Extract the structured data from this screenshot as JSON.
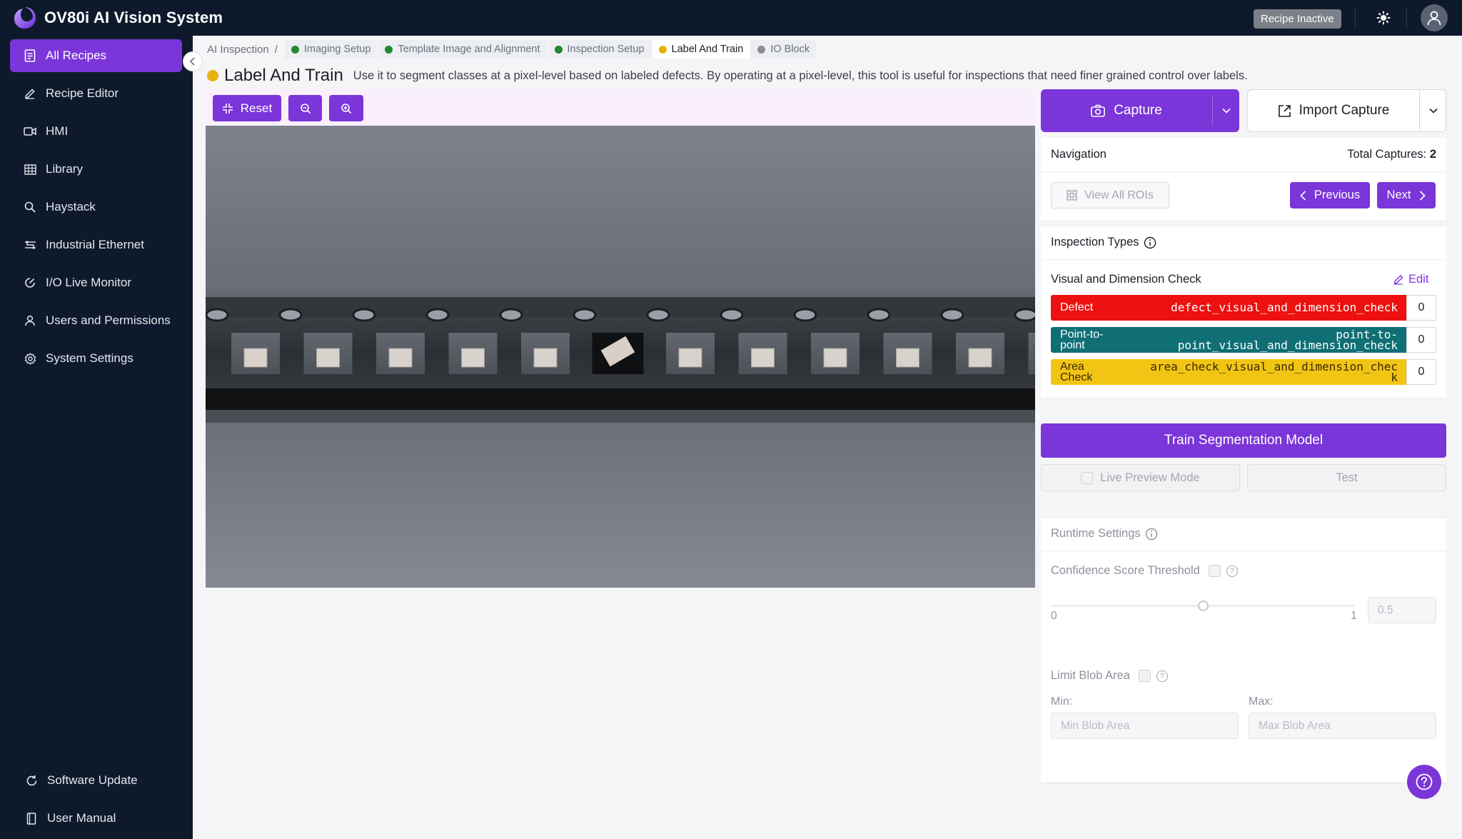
{
  "app": {
    "title": "OV80i AI Vision System",
    "status_badge": "Recipe Inactive"
  },
  "sidebar": {
    "items": [
      {
        "label": "All Recipes",
        "icon": "document-list-icon",
        "active": true
      },
      {
        "label": "Recipe Editor",
        "icon": "pencil-icon"
      },
      {
        "label": "HMI",
        "icon": "video-icon"
      },
      {
        "label": "Library",
        "icon": "grid-icon"
      },
      {
        "label": "Haystack",
        "icon": "search-icon"
      },
      {
        "label": "Industrial Ethernet",
        "icon": "network-icon"
      },
      {
        "label": "I/O Live Monitor",
        "icon": "gauge-icon"
      },
      {
        "label": "Users and Permissions",
        "icon": "user-icon"
      },
      {
        "label": "System Settings",
        "icon": "gear-icon"
      }
    ],
    "bottom": [
      {
        "label": "Software Update",
        "icon": "refresh-icon"
      },
      {
        "label": "User Manual",
        "icon": "book-icon"
      }
    ]
  },
  "breadcrumb": {
    "root": "AI Inspection",
    "sep": "/",
    "steps": [
      {
        "label": "Imaging Setup",
        "color": "#1f8a2e"
      },
      {
        "label": "Template Image and Alignment",
        "color": "#1f8a2e"
      },
      {
        "label": "Inspection Setup",
        "color": "#1f8a2e"
      },
      {
        "label": "Label And Train",
        "color": "#e8b20e",
        "active": true
      },
      {
        "label": "IO Block",
        "color": "#8a8d94"
      }
    ]
  },
  "page": {
    "title": "Label And Train",
    "description": "Use it to segment classes at a pixel-level based on labeled defects. By operating at a pixel-level, this tool is useful for inspections that need finer grained control over labels."
  },
  "viewer": {
    "reset_label": "Reset"
  },
  "capture": {
    "capture_label": "Capture",
    "import_label": "Import Capture"
  },
  "navigation": {
    "title": "Navigation",
    "total_label": "Total Captures:",
    "total_value": "2",
    "view_all_label": "View All ROIs",
    "previous_label": "Previous",
    "next_label": "Next"
  },
  "inspection_types": {
    "title": "Inspection Types",
    "group_name": "Visual and Dimension Check",
    "edit_label": "Edit",
    "types": [
      {
        "name_lines": [
          "Defect"
        ],
        "code_lines": [
          "defect_visual_and_dimension_check"
        ],
        "count": "0",
        "color": "#ee1111",
        "text_color": "#ffffff"
      },
      {
        "name_lines": [
          "Point-to-",
          "point"
        ],
        "code_lines": [
          "point-to-",
          "point_visual_and_dimension_check"
        ],
        "count": "0",
        "color": "#0f6f74",
        "text_color": "#ffffff"
      },
      {
        "name_lines": [
          "Area",
          "Check"
        ],
        "code_lines": [
          "area_check_visual_and_dimension_chec",
          "k"
        ],
        "count": "0",
        "color": "#f2c414",
        "text_color": "#3a2a00"
      }
    ]
  },
  "training": {
    "train_label": "Train Segmentation Model",
    "live_preview_label": "Live Preview Mode",
    "test_label": "Test"
  },
  "runtime": {
    "title": "Runtime Settings",
    "confidence_label": "Confidence Score Threshold",
    "confidence_min": "0",
    "confidence_max": "1",
    "confidence_value": "0.5",
    "confidence_fraction": 0.5,
    "blob_label": "Limit Blob Area",
    "min_label": "Min:",
    "max_label": "Max:",
    "min_placeholder": "Min Blob Area",
    "max_placeholder": "Max Blob Area"
  },
  "colors": {
    "accent": "#7b35d9",
    "nav_bg": "#0e1a2c"
  }
}
